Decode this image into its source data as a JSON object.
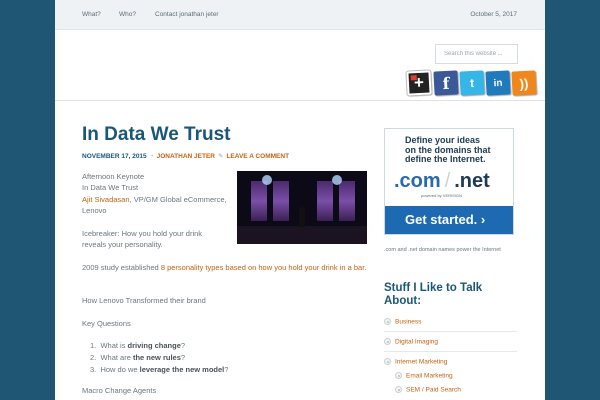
{
  "nav": {
    "items": [
      "What?",
      "Who?",
      "Contact jonathan jeter"
    ],
    "date": "October 5, 2017"
  },
  "search": {
    "placeholder": "Search this website ..."
  },
  "social": [
    "google-plus-icon",
    "facebook-icon",
    "twitter-icon",
    "linkedin-icon",
    "rss-icon"
  ],
  "post": {
    "title": "In Data We Trust",
    "date": "NOVEMBER 17, 2015",
    "author": "JONATHAN JETER",
    "comment": "LEAVE A COMMENT",
    "line1": "Afternoon Keynote",
    "line2": "In Data We Trust",
    "speaker_name": "Ajit Sivadasan",
    "speaker_role": ", VP/GM Global eCommerce,",
    "speaker_company": "Lenovo",
    "icebreaker": "Icebreaker: How you hold your drink reveals your personality.",
    "study_prefix": "2009 study established ",
    "study_link": "8 personality types based on how you hold your drink in a bar",
    "study_suffix": ".",
    "transform": "How Lenovo Transformed their brand",
    "key_questions": "Key Questions",
    "q1_prefix": "What is ",
    "q1_bold": "driving change",
    "q1_suffix": "?",
    "q2_prefix": "What are ",
    "q2_bold": "the new rules",
    "q2_suffix": "?",
    "q3_prefix": "How do we ",
    "q3_bold": "leverage the new model",
    "q3_suffix": "?",
    "macro": "Macro Change Agents"
  },
  "ad": {
    "tagline": "Define your ideas on the domains that define the Internet.",
    "tagline_1": "Define your ideas",
    "tagline_2": "on the domains that",
    "tagline_3": "define the Internet.",
    "com": ".com",
    "net": ".net",
    "powered": "powered by VERISIGN",
    "cta": "Get started. ›",
    "caption": ".com and .net domain names power the Internet"
  },
  "sidebar": {
    "heading": "Stuff I Like to Talk About:",
    "categories": [
      {
        "label": "Business",
        "level": 0
      },
      {
        "label": "Digital Imaging",
        "level": 0
      },
      {
        "label": "Internet Marketing",
        "level": 0
      },
      {
        "label": "Email Marketing",
        "level": 1
      },
      {
        "label": "SEM / Paid Search",
        "level": 1
      }
    ]
  },
  "colors": {
    "accent": "#c26314",
    "title": "#1a5777",
    "background": "#1e5674"
  }
}
